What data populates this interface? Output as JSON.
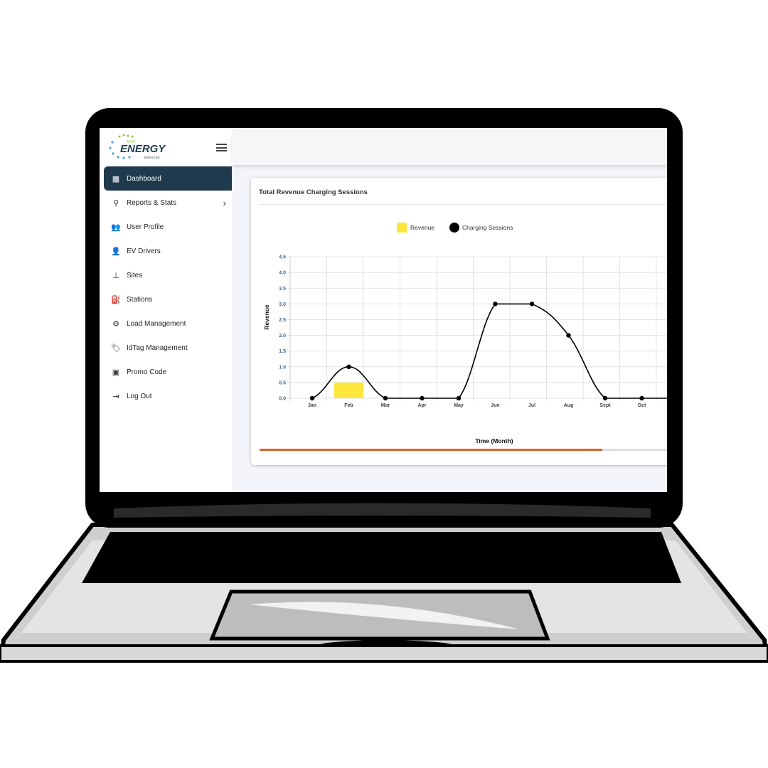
{
  "brand": {
    "logo_text": "ENERGY",
    "logo_subtext": "SERVICES",
    "logo_top": "ACDI"
  },
  "sidebar": {
    "items": [
      {
        "label": "Dashboard",
        "icon": "dashboard-icon",
        "active": true
      },
      {
        "label": "Reports & Stats",
        "icon": "reports-icon",
        "has_submenu": true
      },
      {
        "label": "User Profile",
        "icon": "users-icon"
      },
      {
        "label": "EV Drivers",
        "icon": "driver-icon"
      },
      {
        "label": "Sites",
        "icon": "sitemap-icon"
      },
      {
        "label": "Stations",
        "icon": "charging-station-icon"
      },
      {
        "label": "Load Management",
        "icon": "gears-icon"
      },
      {
        "label": "IdTag Management",
        "icon": "tag-icon"
      },
      {
        "label": "Promo Code",
        "icon": "ticket-icon"
      },
      {
        "label": "Log Out",
        "icon": "logout-icon"
      }
    ]
  },
  "card": {
    "title": "Total Revenue Charging Sessions",
    "scroll_progress": 0.82
  },
  "colors": {
    "sidebar_active": "#1f3a4d",
    "revenue": "#fde73c",
    "sessions": "#000000",
    "scrollbar": "#e0612a",
    "tick_label": "#3d6a96"
  },
  "chart_data": {
    "type": "bar+line",
    "categories": [
      "Jan",
      "Feb",
      "Mar",
      "Apr",
      "May",
      "Jun",
      "Jul",
      "Aug",
      "Sept",
      "Oct"
    ],
    "series": [
      {
        "name": "Revenue",
        "type": "bar",
        "values": [
          0,
          0.5,
          0,
          0,
          0,
          0,
          0,
          0,
          0,
          0
        ]
      },
      {
        "name": "Charging Sessions",
        "type": "line",
        "values": [
          0,
          1,
          0,
          0,
          0,
          3,
          3,
          2,
          0,
          0
        ]
      }
    ],
    "xlabel": "Time (Month)",
    "ylabel": "Revenue",
    "ylim": [
      0,
      4.5
    ],
    "yticks": [
      "0.0",
      "0.5",
      "1.0",
      "1.5",
      "2.0",
      "2.5",
      "3.0",
      "3.5",
      "4.0",
      "4.5"
    ],
    "grid": true,
    "legend": "top"
  }
}
